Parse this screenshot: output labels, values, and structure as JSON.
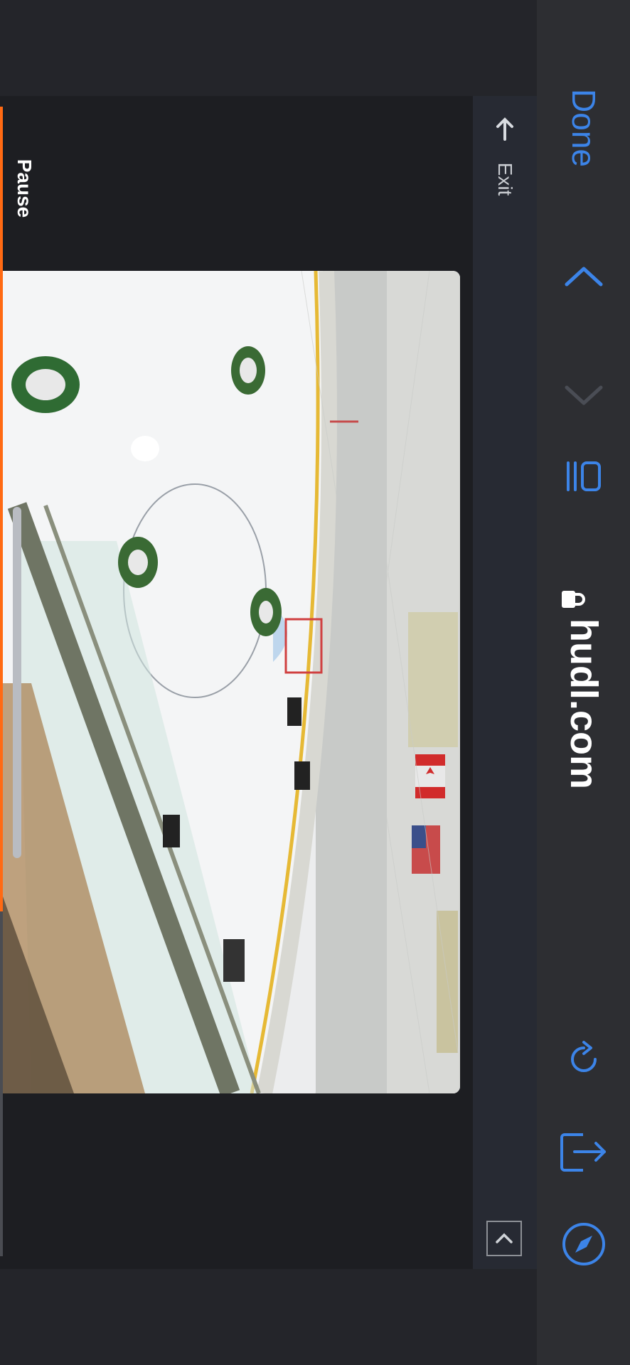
{
  "browser": {
    "done_label": "Done",
    "url": "hudl.com",
    "icons": {
      "prev": "chevron-up-icon",
      "next": "chevron-down-icon",
      "reader": "reader-icon",
      "lock": "lock-icon",
      "reload": "reload-icon",
      "share": "share-icon",
      "safari": "compass-icon"
    },
    "accent_color": "#3c84e8"
  },
  "player": {
    "pause_label": "Pause",
    "exit_label": "Exit",
    "progress_fraction": 0.7,
    "accent_color": "#ff6a13"
  }
}
